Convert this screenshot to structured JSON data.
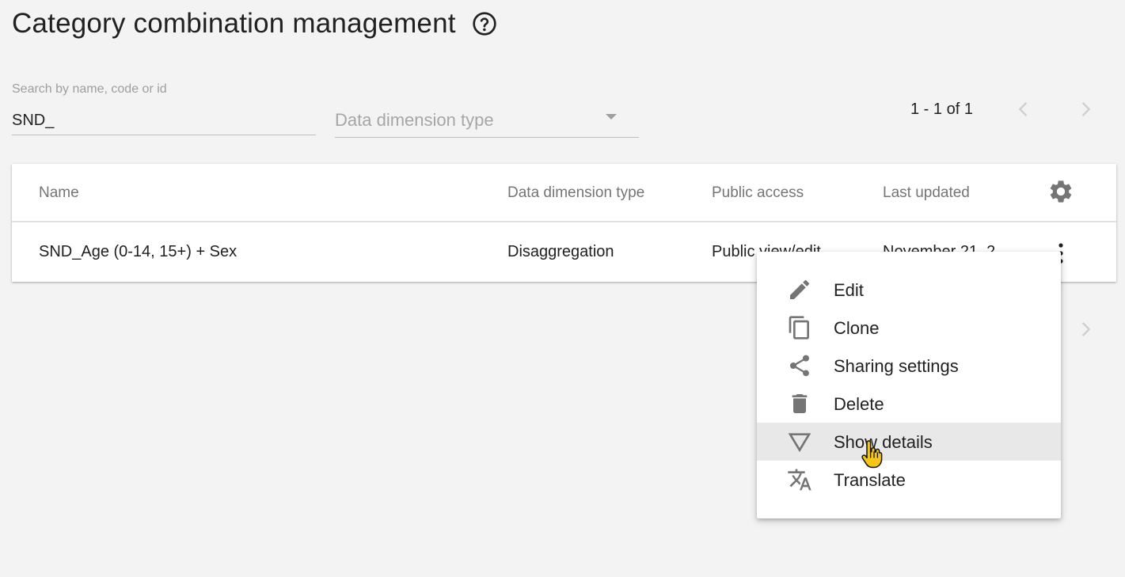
{
  "page": {
    "title": "Category combination management"
  },
  "search": {
    "label": "Search by name, code or id",
    "value": "SND_"
  },
  "filter": {
    "placeholder": "Data dimension type"
  },
  "pager": {
    "text": "1 - 1 of 1"
  },
  "table": {
    "columns": [
      "Name",
      "Data dimension type",
      "Public access",
      "Last updated"
    ],
    "rows": [
      {
        "name": "SND_Age (0-14, 15+) + Sex",
        "type": "Disaggregation",
        "access": "Public view/edit",
        "updated": "November 21, 2"
      }
    ]
  },
  "menu": {
    "items": [
      {
        "label": "Edit",
        "icon": "pencil-icon"
      },
      {
        "label": "Clone",
        "icon": "copy-icon"
      },
      {
        "label": "Sharing settings",
        "icon": "share-icon"
      },
      {
        "label": "Delete",
        "icon": "trash-icon"
      },
      {
        "label": "Show details",
        "icon": "triangle-down-icon"
      },
      {
        "label": "Translate",
        "icon": "translate-icon"
      }
    ],
    "hovered": "Show details"
  },
  "colors": {
    "background": "#f3f3f3",
    "icon": "#757575",
    "hover": "#e8e8e8",
    "cursor": "#f5c518"
  }
}
